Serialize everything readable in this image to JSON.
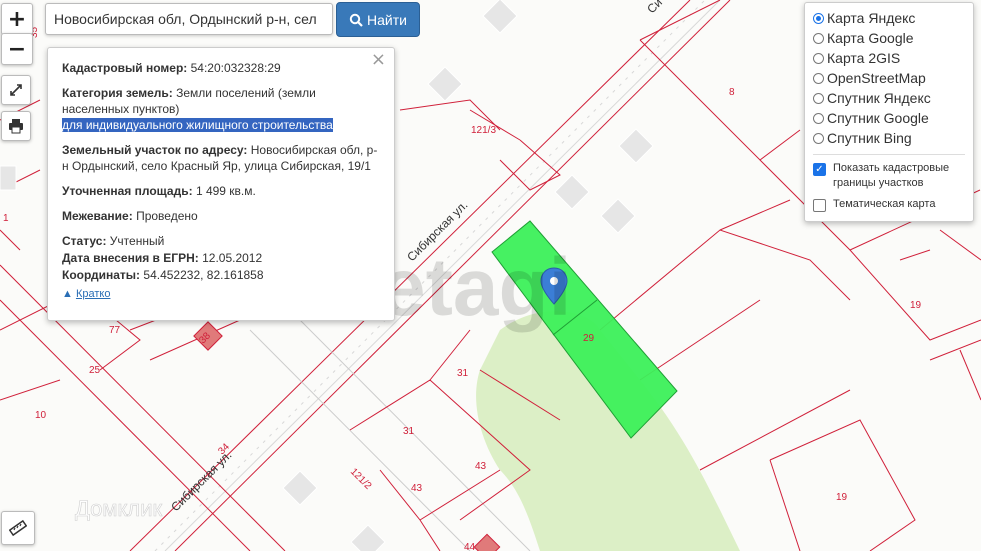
{
  "search": {
    "value": "Новосибирская обл, Ордынский р-н, сел",
    "button_label": "Найти"
  },
  "zoom": {
    "in": "+",
    "out": "−"
  },
  "popup": {
    "cadastral_label": "Кадастровый номер:",
    "cadastral_value": "54:20:032328:29",
    "category_label": "Категория земель:",
    "category_value": "Земли поселений (земли населенных пунктов)",
    "category_use": "для индивидуального жилищного строительства",
    "address_label": "Земельный участок по адресу:",
    "address_value": "Новосибирская обл, р-н Ордынский, село Красный Яр, улица Сибирская, 19/1",
    "area_label": "Уточненная площадь:",
    "area_value": "1 499 кв.м.",
    "survey_label": "Межевание:",
    "survey_value": "Проведено",
    "status_label": "Статус:",
    "status_value": "Учтенный",
    "date_label": "Дата внесения в ЕГРН:",
    "date_value": "12.05.2012",
    "coords_label": "Координаты:",
    "coords_value": "54.452232, 82.161858",
    "brief_link": "Кратко",
    "close": "×"
  },
  "layers": {
    "options": [
      {
        "label": "Карта Яндекс",
        "checked": true
      },
      {
        "label": "Карта Google",
        "checked": false
      },
      {
        "label": "Карта 2GIS",
        "checked": false
      },
      {
        "label": "OpenStreetMap",
        "checked": false
      },
      {
        "label": "Спутник Яндекс",
        "checked": false
      },
      {
        "label": "Спутник Google",
        "checked": false
      },
      {
        "label": "Спутник Bing",
        "checked": false
      }
    ],
    "show_cadastral": "Показать кадастровые границы участков",
    "thematic": "Тематическая карта"
  },
  "map_labels": {
    "street_main": "Сибирская ул.",
    "street_lower": "Сибирская ул.",
    "street_top": "Си",
    "n_8": "8",
    "n_121_3": "121/3",
    "n_1": "1",
    "n_19a": "19",
    "n_19b": "19",
    "n_29": "29",
    "n_31a": "31",
    "n_31b": "31",
    "n_43a": "43",
    "n_43b": "43",
    "n_77": "77",
    "n_25": "25",
    "n_10": "10",
    "n_121_2": "121/2",
    "n_44": "44",
    "n_38": "38",
    "n_34": "34",
    "n_35": "35",
    "watermark": "etagi",
    "watermark2": "Домклик"
  },
  "colors": {
    "parcel": "#3cf05a",
    "border": "#d0203a",
    "forest": "#dcefc6",
    "accent": "#3979b9"
  }
}
